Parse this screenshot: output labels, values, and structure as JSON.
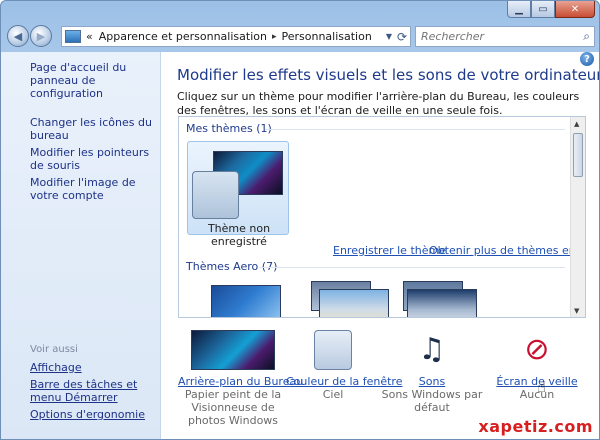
{
  "window": {
    "caption": {
      "minimize": "▁",
      "maximize": "▭",
      "close": "✕"
    }
  },
  "navbar": {
    "back_glyph": "◀",
    "forward_glyph": "▶",
    "address": {
      "prefix": "«",
      "segments": [
        "Apparence et personnalisation",
        "Personnalisation"
      ],
      "separator": "▸"
    },
    "search_placeholder": "Rechercher"
  },
  "sidebar": {
    "home_link": "Page d'accueil du panneau de configuration",
    "links": [
      "Changer les icônes du bureau",
      "Modifier les pointeurs de souris",
      "Modifier l'image de votre compte"
    ],
    "see_also_title": "Voir aussi",
    "see_also_links": [
      "Affichage",
      "Barre des tâches et menu Démarrer",
      "Options d'ergonomie"
    ]
  },
  "main": {
    "title": "Modifier les effets visuels et les sons de votre ordinateur",
    "description": "Cliquez sur un thème pour modifier l'arrière-plan du Bureau, les couleurs des fenêtres, les sons et l'écran de veille en une seule fois.",
    "themes": {
      "my_themes_header": "Mes thèmes (1)",
      "my_theme_label": "Thème non enregistré",
      "save_theme_link": "Enregistrer le thème",
      "get_more_link": "Obtenir plus de thèmes en ligne",
      "aero_header": "Thèmes Aero (7)"
    },
    "bottom_items": [
      {
        "link": "Arrière-plan du Bureau",
        "sub": "Papier peint de la Visionneuse de photos Windows"
      },
      {
        "link": "Couleur de la fenêtre",
        "sub": "Ciel"
      },
      {
        "link": "Sons",
        "sub": "Sons Windows par défaut"
      },
      {
        "link": "Écran de veille",
        "sub": "Aucun"
      }
    ]
  },
  "icons": {
    "help": "?",
    "refresh": "⟳",
    "search": "⌕",
    "sound": "♫",
    "saver": "⊘",
    "cursor": "☝"
  },
  "watermark": "xapetiz.com",
  "colors": {
    "link": "#1e50b4",
    "title": "#1e3a8c",
    "sidebar_link": "#1e3287"
  }
}
